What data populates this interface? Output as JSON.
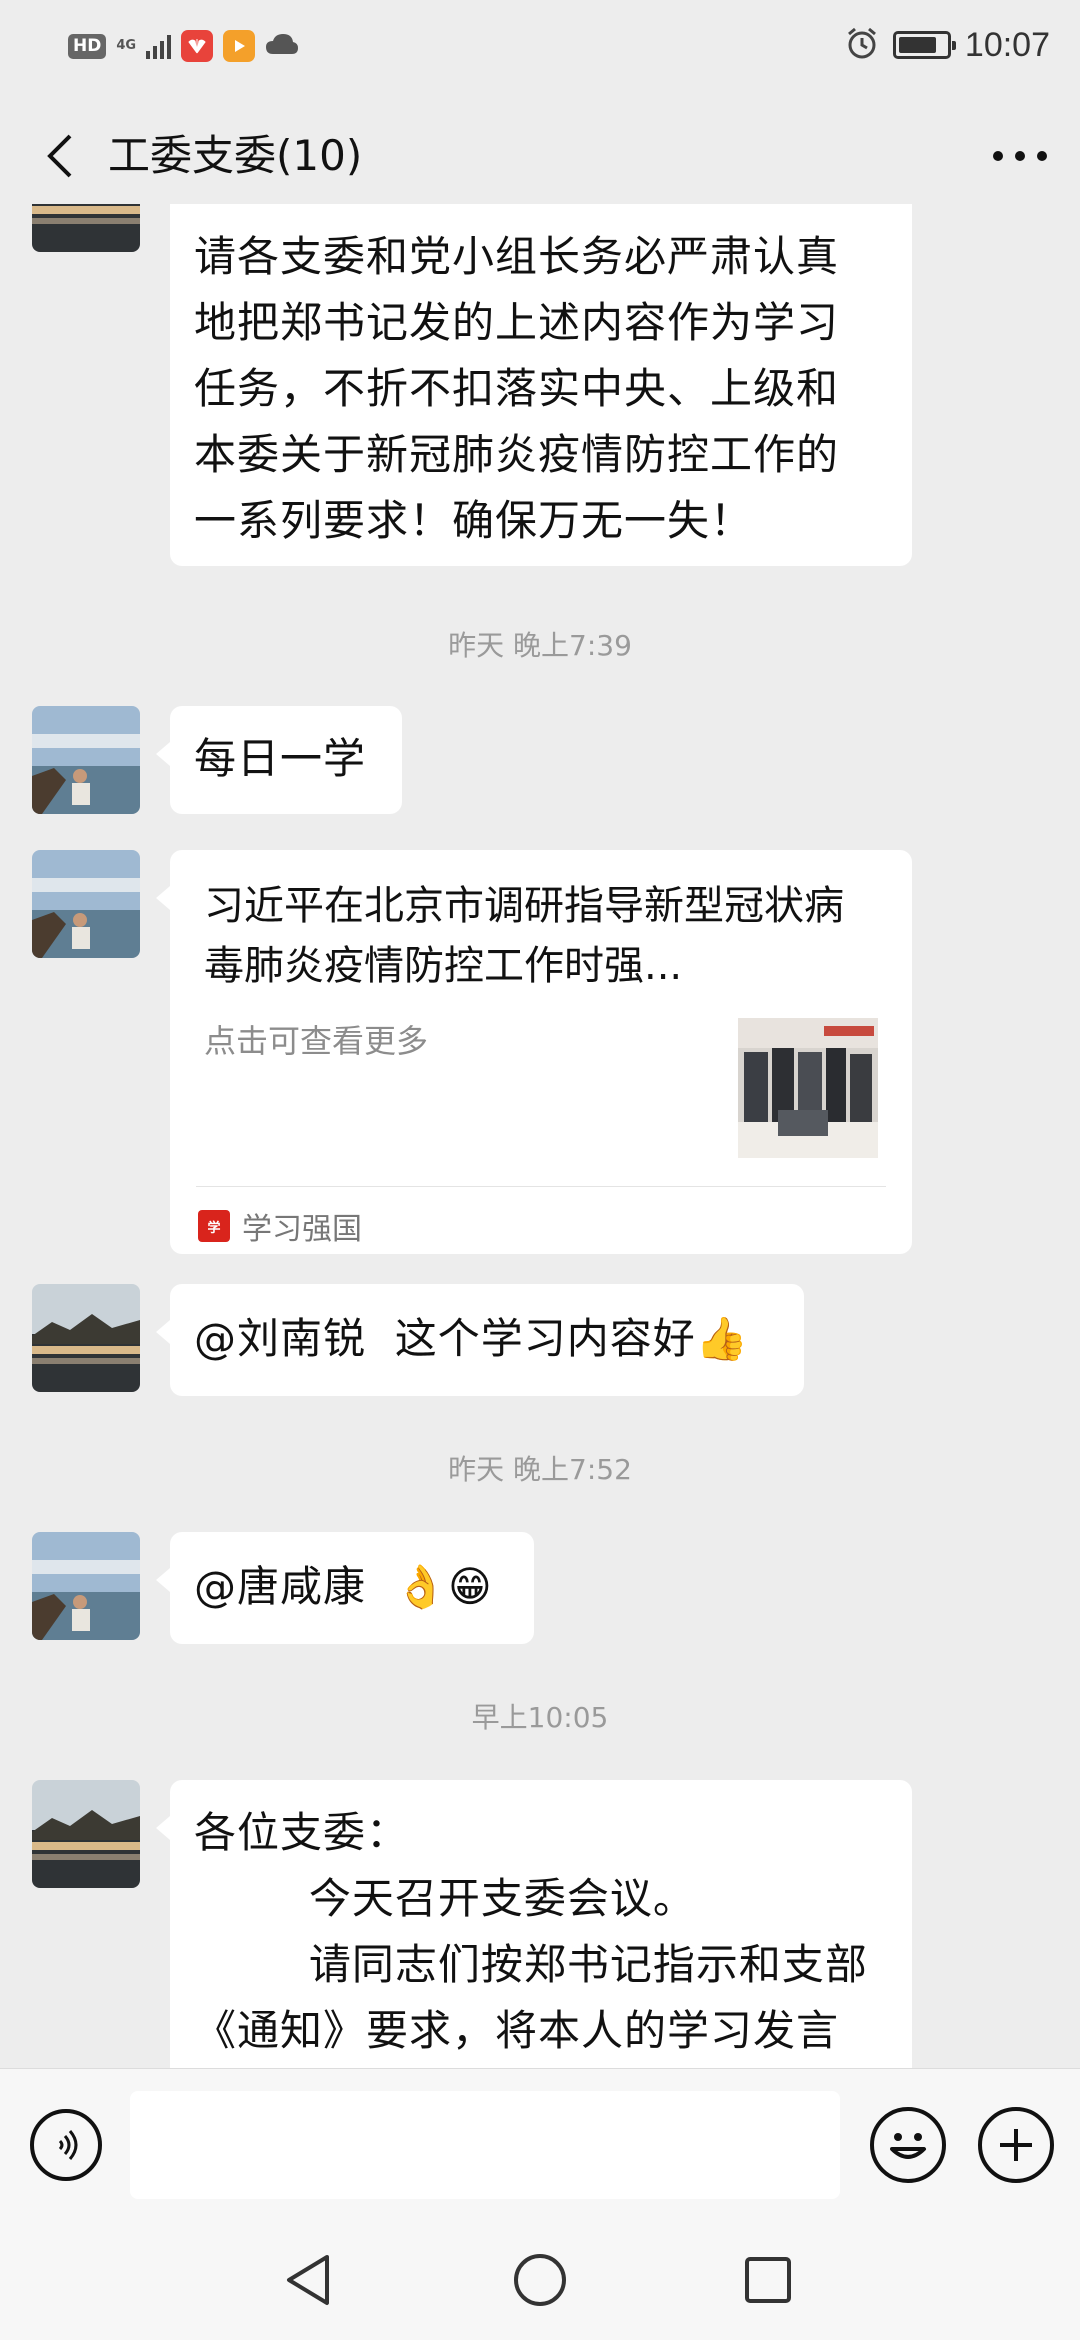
{
  "status_bar": {
    "network_badge": "HD",
    "network_type": "4G",
    "time": "10:07",
    "battery_level_percent": 80,
    "icons": [
      "signal-icon",
      "huawei-app-icon",
      "video-app-icon",
      "cloud-icon",
      "alarm-icon",
      "battery-icon"
    ]
  },
  "header": {
    "title": "工委支委(10)",
    "back_icon": "chevron-left-icon",
    "more_icon": "more-dots-icon"
  },
  "messages": [
    {
      "type": "text",
      "text": "请各支委和党小组长务必严肃认真\n地把郑书记发的上述内容作为学习\n任务，不折不扣落实中央、上级和\n本委关于新冠肺炎疫情防控工作的\n一系列要求！确保万无一失！"
    },
    {
      "type": "time",
      "text": "昨天 晚上7:39"
    },
    {
      "type": "text",
      "text": "每日一学"
    },
    {
      "type": "card",
      "title": "习近平在北京市调研指导新型冠状病毒肺炎疫情防控工作时强...",
      "description": "点击可查看更多",
      "source": "学习强国"
    },
    {
      "type": "text",
      "text": "@刘南锐  这个学习内容好👍"
    },
    {
      "type": "time",
      "text": "昨天 晚上7:52"
    },
    {
      "type": "text",
      "text": "@唐咸康  👌😁"
    },
    {
      "type": "time",
      "text": "早上10:05"
    },
    {
      "type": "text",
      "text": "各位支委：\n        今天召开支委会议。\n        请同志们按郑书记指示和支部\n《通知》要求，将本人的学习发言"
    }
  ],
  "input_bar": {
    "placeholder": "",
    "value": "",
    "icons": [
      "voice-icon",
      "emoji-icon",
      "plus-icon"
    ]
  },
  "nav_bar": {
    "icons": [
      "nav-back-icon",
      "nav-home-icon",
      "nav-recents-icon"
    ]
  },
  "colors": {
    "background": "#ededed",
    "bubble": "#ffffff",
    "timestamp": "#9a9a9a",
    "source_badge": "#d9241c"
  }
}
